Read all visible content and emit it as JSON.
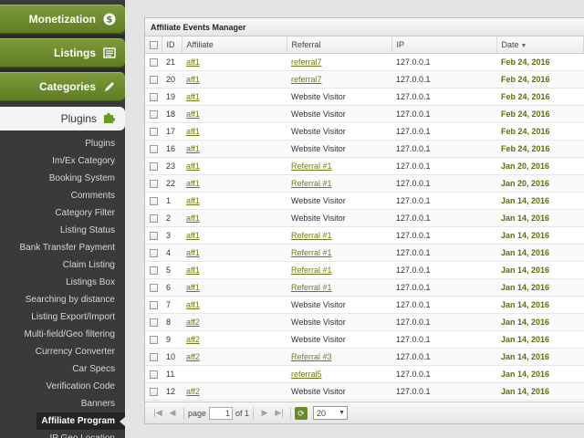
{
  "sidebar": {
    "top_items": [
      {
        "label": "Monetization",
        "icon": "dollar-icon"
      },
      {
        "label": "Listings",
        "icon": "listings-icon"
      },
      {
        "label": "Categories",
        "icon": "pencil-icon"
      }
    ],
    "plugins_header": {
      "label": "Plugins",
      "icon": "puzzle-icon"
    },
    "sub_items": [
      "Plugins",
      "Im/Ex Category",
      "Booking System",
      "Comments",
      "Category Filter",
      "Listing Status",
      "Bank Transfer Payment",
      "Claim Listing",
      "Listings Box",
      "Searching by distance",
      "Listing Export/Import",
      "Multi-field/Geo filtering",
      "Currency Converter",
      "Car Specs",
      "Verification Code",
      "Banners",
      "Affiliate Program",
      "IP Geo Location"
    ],
    "active_sub_item": "Affiliate Program"
  },
  "panel": {
    "title": "Affiliate Events Manager",
    "columns": {
      "id": "ID",
      "affiliate": "Affiliate",
      "referral": "Referral",
      "ip": "IP",
      "date": "Date"
    },
    "rows": [
      {
        "id": "21",
        "affiliate": "aff1",
        "referral": "referral7",
        "referral_link": true,
        "ip": "127.0.0.1",
        "date": "Feb 24, 2016"
      },
      {
        "id": "20",
        "affiliate": "aff1",
        "referral": "referral7",
        "referral_link": true,
        "ip": "127.0.0.1",
        "date": "Feb 24, 2016"
      },
      {
        "id": "19",
        "affiliate": "aff1",
        "referral": "Website Visitor",
        "referral_link": false,
        "ip": "127.0.0.1",
        "date": "Feb 24, 2016"
      },
      {
        "id": "18",
        "affiliate": "aff1",
        "referral": "Website Visitor",
        "referral_link": false,
        "ip": "127.0.0.1",
        "date": "Feb 24, 2016"
      },
      {
        "id": "17",
        "affiliate": "aff1",
        "referral": "Website Visitor",
        "referral_link": false,
        "ip": "127.0.0.1",
        "date": "Feb 24, 2016"
      },
      {
        "id": "16",
        "affiliate": "aff1",
        "referral": "Website Visitor",
        "referral_link": false,
        "ip": "127.0.0.1",
        "date": "Feb 24, 2016"
      },
      {
        "id": "23",
        "affiliate": "aff1",
        "referral": "Referral #1",
        "referral_link": true,
        "ip": "127.0.0.1",
        "date": "Jan 20, 2016"
      },
      {
        "id": "22",
        "affiliate": "aff1",
        "referral": "Referral #1",
        "referral_link": true,
        "ip": "127.0.0.1",
        "date": "Jan 20, 2016"
      },
      {
        "id": "1",
        "affiliate": "aff1",
        "referral": "Website Visitor",
        "referral_link": false,
        "ip": "127.0.0.1",
        "date": "Jan 14, 2016"
      },
      {
        "id": "2",
        "affiliate": "aff1",
        "referral": "Website Visitor",
        "referral_link": false,
        "ip": "127.0.0.1",
        "date": "Jan 14, 2016"
      },
      {
        "id": "3",
        "affiliate": "aff1",
        "referral": "Referral #1",
        "referral_link": true,
        "ip": "127.0.0.1",
        "date": "Jan 14, 2016"
      },
      {
        "id": "4",
        "affiliate": "aff1",
        "referral": "Referral #1",
        "referral_link": true,
        "ip": "127.0.0.1",
        "date": "Jan 14, 2016"
      },
      {
        "id": "5",
        "affiliate": "aff1",
        "referral": "Referral #1",
        "referral_link": true,
        "ip": "127.0.0.1",
        "date": "Jan 14, 2016"
      },
      {
        "id": "6",
        "affiliate": "aff1",
        "referral": "Referral #1",
        "referral_link": true,
        "ip": "127.0.0.1",
        "date": "Jan 14, 2016"
      },
      {
        "id": "7",
        "affiliate": "aff1",
        "referral": "Website Visitor",
        "referral_link": false,
        "ip": "127.0.0.1",
        "date": "Jan 14, 2016"
      },
      {
        "id": "8",
        "affiliate": "aff2",
        "referral": "Website Visitor",
        "referral_link": false,
        "ip": "127.0.0.1",
        "date": "Jan 14, 2016"
      },
      {
        "id": "9",
        "affiliate": "aff2",
        "referral": "Website Visitor",
        "referral_link": false,
        "ip": "127.0.0.1",
        "date": "Jan 14, 2016"
      },
      {
        "id": "10",
        "affiliate": "aff2",
        "referral": "Referral #3",
        "referral_link": true,
        "ip": "127.0.0.1",
        "date": "Jan 14, 2016"
      },
      {
        "id": "11",
        "affiliate": "",
        "referral": "referral5",
        "referral_link": true,
        "ip": "127.0.0.1",
        "date": "Jan 14, 2016"
      },
      {
        "id": "12",
        "affiliate": "aff2",
        "referral": "Website Visitor",
        "referral_link": false,
        "ip": "127.0.0.1",
        "date": "Jan 14, 2016"
      }
    ]
  },
  "pager": {
    "page_label": "page",
    "page_value": "1",
    "of_label": "of 1",
    "page_size": "20"
  },
  "colors": {
    "accent": "#6b7f16",
    "sidebar_bg": "#3a3a3a",
    "green_button": "#6b8a2c"
  }
}
